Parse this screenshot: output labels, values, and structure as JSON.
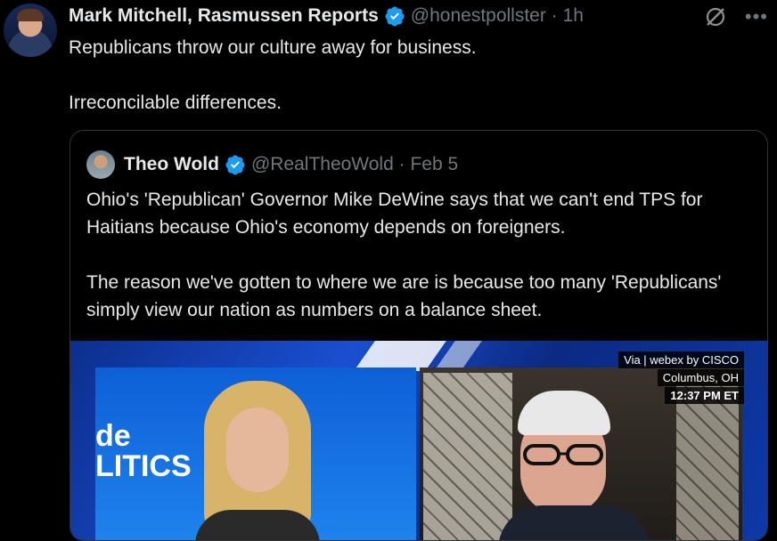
{
  "post": {
    "author_name": "Mark Mitchell, Rasmussen Reports",
    "handle_time": "@honestpollster · 1h",
    "text_line1": "Republicans throw our culture away for business.",
    "text_line2": "Irreconcilable differences."
  },
  "quoted": {
    "author_name": "Theo Wold",
    "handle_time": "@RealTheoWold · Feb 5",
    "para1": "Ohio's 'Republican' Governor Mike DeWine says that we can't end TPS for Haitians because Ohio's economy depends on foreigners.",
    "para2": "The reason we've gotten to where we are is because too many 'Republicans' simply view our nation as numbers on a balance sheet.",
    "media": {
      "via_label": "Via | webex by CISCO",
      "location": "Columbus, OH",
      "time": "12:37 PM ET",
      "studio_text": "de\nLITICS"
    }
  },
  "icons": {
    "verified": "verified-badge-icon",
    "grok": "grok-icon",
    "more": "more-icon"
  },
  "colors": {
    "verified": "#1d9bf0",
    "secondary_text": "#71767b",
    "border": "#2f3336"
  }
}
